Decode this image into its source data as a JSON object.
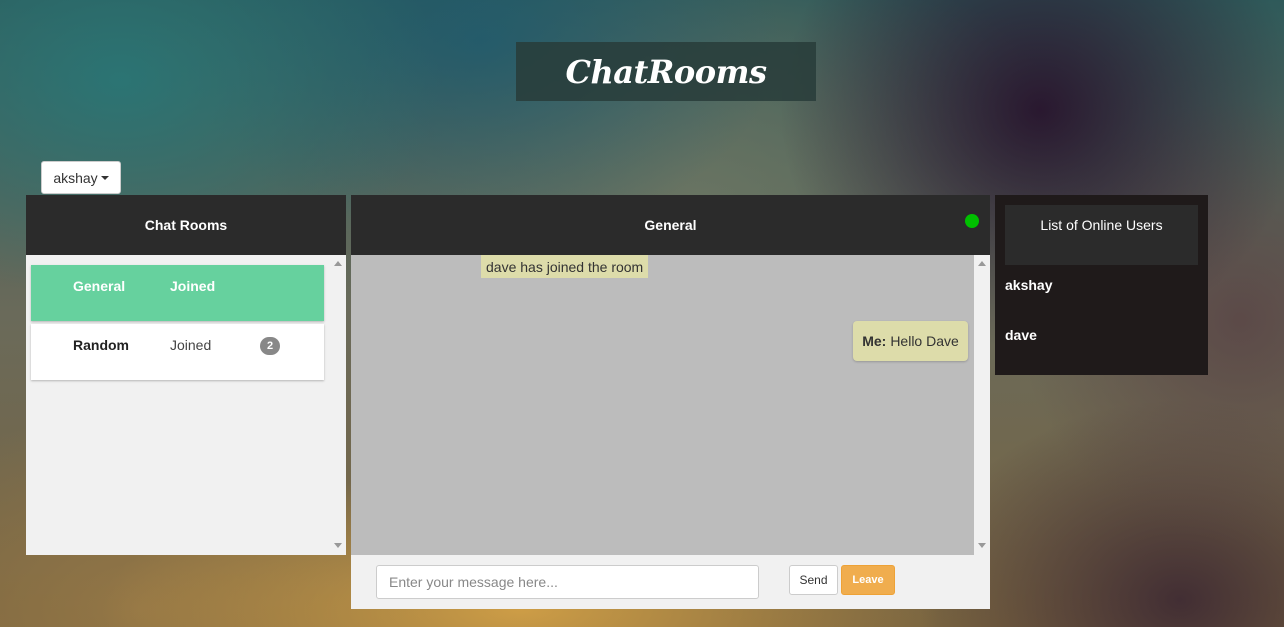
{
  "app": {
    "title": "ChatRooms"
  },
  "user_menu": {
    "username": "akshay"
  },
  "rooms_panel": {
    "title": "Chat Rooms",
    "rooms": [
      {
        "name": "General",
        "status": "Joined",
        "unread": ""
      },
      {
        "name": "Random",
        "status": "Joined",
        "unread": "2"
      }
    ]
  },
  "chat": {
    "room_name": "General",
    "online_indicator_color": "#00c000",
    "messages": [
      {
        "type": "system",
        "text": "dave has joined the room"
      },
      {
        "type": "own",
        "sender": "Me:",
        "text": "Hello Dave"
      }
    ],
    "input": {
      "placeholder": "Enter your message here...",
      "value": ""
    },
    "send_label": "Send",
    "leave_label": "Leave"
  },
  "users_panel": {
    "title": "List of Online Users",
    "users": [
      "akshay",
      "dave"
    ]
  },
  "colors": {
    "active_room": "#66d19e",
    "panel_header": "#2b2b2b",
    "message_bubble": "#dddcaa",
    "leave_button": "#f0ad4e"
  }
}
